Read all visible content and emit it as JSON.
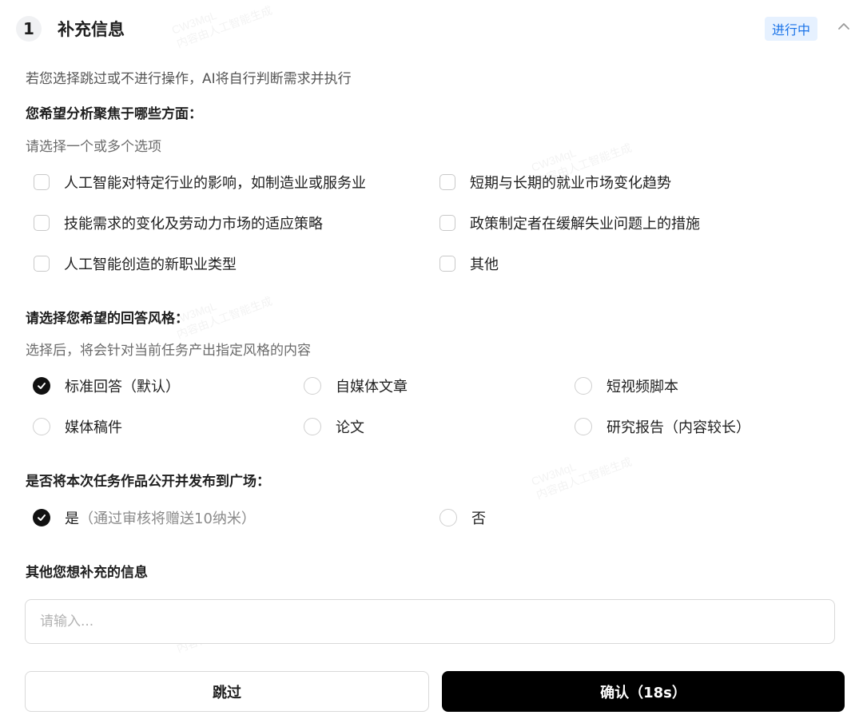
{
  "header": {
    "step_number": "1",
    "title": "补充信息",
    "status": "进行中"
  },
  "hint": "若您选择跳过或不进行操作，AI将自行判断需求并执行",
  "focus": {
    "title": "您希望分析聚焦于哪些方面：",
    "subtitle": "请选择一个或多个选项",
    "options": [
      {
        "label": "人工智能对特定行业的影响，如制造业或服务业",
        "checked": false
      },
      {
        "label": "短期与长期的就业市场变化趋势",
        "checked": false
      },
      {
        "label": "技能需求的变化及劳动力市场的适应策略",
        "checked": false
      },
      {
        "label": "政策制定者在缓解失业问题上的措施",
        "checked": false
      },
      {
        "label": "人工智能创造的新职业类型",
        "checked": false
      },
      {
        "label": "其他",
        "checked": false
      }
    ]
  },
  "style": {
    "title": "请选择您希望的回答风格：",
    "subtitle": "选择后，将会针对当前任务产出指定风格的内容",
    "options": [
      {
        "label": "标准回答（默认）",
        "selected": true
      },
      {
        "label": "自媒体文章",
        "selected": false
      },
      {
        "label": "短视频脚本",
        "selected": false
      },
      {
        "label": "媒体稿件",
        "selected": false
      },
      {
        "label": "论文",
        "selected": false
      },
      {
        "label": "研究报告（内容较长）",
        "selected": false
      }
    ]
  },
  "publish": {
    "title": "是否将本次任务作品公开并发布到广场：",
    "yes_label": "是",
    "yes_note": "（通过审核将赠送10纳米）",
    "no_label": "否",
    "selected": "yes"
  },
  "extra": {
    "title": "其他您想补充的信息",
    "placeholder": "请输入...",
    "value": ""
  },
  "buttons": {
    "skip": "跳过",
    "confirm": "确认（18s）"
  },
  "watermark": {
    "line1": "CW3MqL",
    "line2": "内容由人工智能生成"
  },
  "colors": {
    "accent": "#1a73e8",
    "badge_bg": "#e6f1ff",
    "primary_button": "#000000"
  }
}
